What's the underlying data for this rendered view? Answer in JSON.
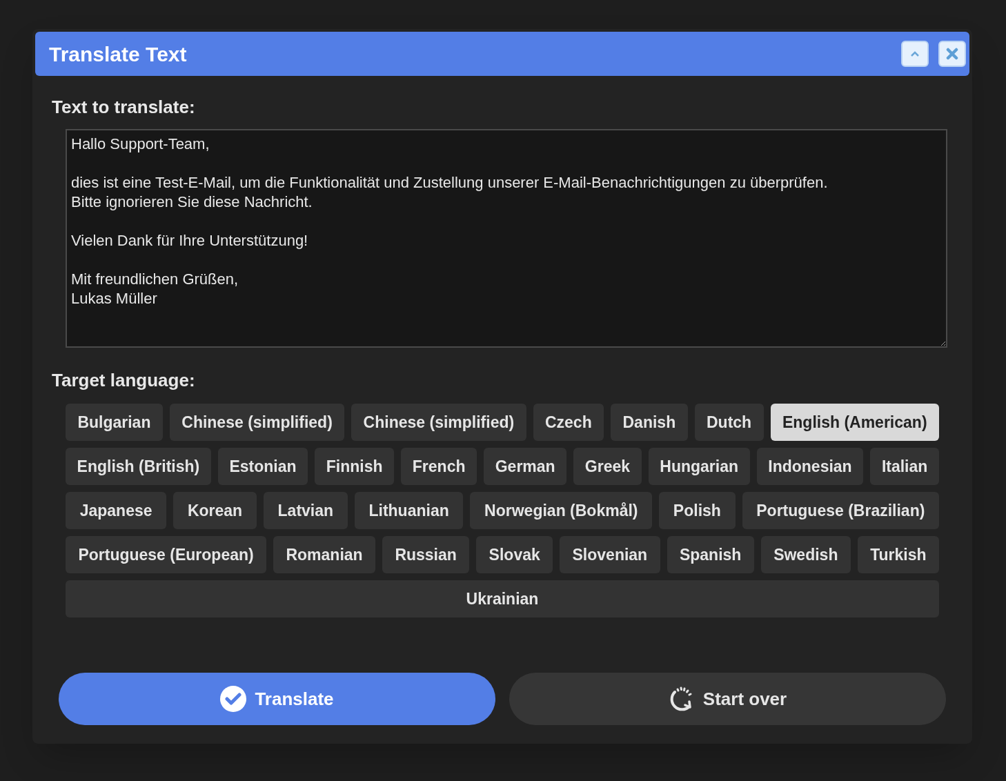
{
  "window": {
    "title": "Translate Text"
  },
  "source": {
    "label": "Text to translate:",
    "value": "Hallo Support-Team,\n\ndies ist eine Test-E-Mail, um die Funktionalität und Zustellung unserer E-Mail-Benachrichtigungen zu überprüfen.\nBitte ignorieren Sie diese Nachricht.\n\nVielen Dank für Ihre Unterstützung!\n\nMit freundlichen Grüßen,\nLukas Müller"
  },
  "target": {
    "label": "Target language:",
    "languages": [
      {
        "label": "Bulgarian",
        "selected": false
      },
      {
        "label": "Chinese (simplified)",
        "selected": false
      },
      {
        "label": "Chinese (simplified)",
        "selected": false
      },
      {
        "label": "Czech",
        "selected": false
      },
      {
        "label": "Danish",
        "selected": false
      },
      {
        "label": "Dutch",
        "selected": false
      },
      {
        "label": "English (American)",
        "selected": true
      },
      {
        "label": "English (British)",
        "selected": false
      },
      {
        "label": "Estonian",
        "selected": false
      },
      {
        "label": "Finnish",
        "selected": false
      },
      {
        "label": "French",
        "selected": false
      },
      {
        "label": "German",
        "selected": false
      },
      {
        "label": "Greek",
        "selected": false
      },
      {
        "label": "Hungarian",
        "selected": false
      },
      {
        "label": "Indonesian",
        "selected": false
      },
      {
        "label": "Italian",
        "selected": false
      },
      {
        "label": "Japanese",
        "selected": false
      },
      {
        "label": "Korean",
        "selected": false
      },
      {
        "label": "Latvian",
        "selected": false
      },
      {
        "label": "Lithuanian",
        "selected": false
      },
      {
        "label": "Norwegian (Bokmål)",
        "selected": false
      },
      {
        "label": "Polish",
        "selected": false
      },
      {
        "label": "Portuguese (Brazilian)",
        "selected": false
      },
      {
        "label": "Portuguese (European)",
        "selected": false
      },
      {
        "label": "Romanian",
        "selected": false
      },
      {
        "label": "Russian",
        "selected": false
      },
      {
        "label": "Slovak",
        "selected": false
      },
      {
        "label": "Slovenian",
        "selected": false
      },
      {
        "label": "Spanish",
        "selected": false
      },
      {
        "label": "Swedish",
        "selected": false
      },
      {
        "label": "Turkish",
        "selected": false
      },
      {
        "label": "Ukrainian",
        "selected": false
      }
    ]
  },
  "buttons": [
    {
      "kind": "primary",
      "label": "Translate"
    },
    {
      "kind": "secondary",
      "label": "Start over"
    }
  ]
}
